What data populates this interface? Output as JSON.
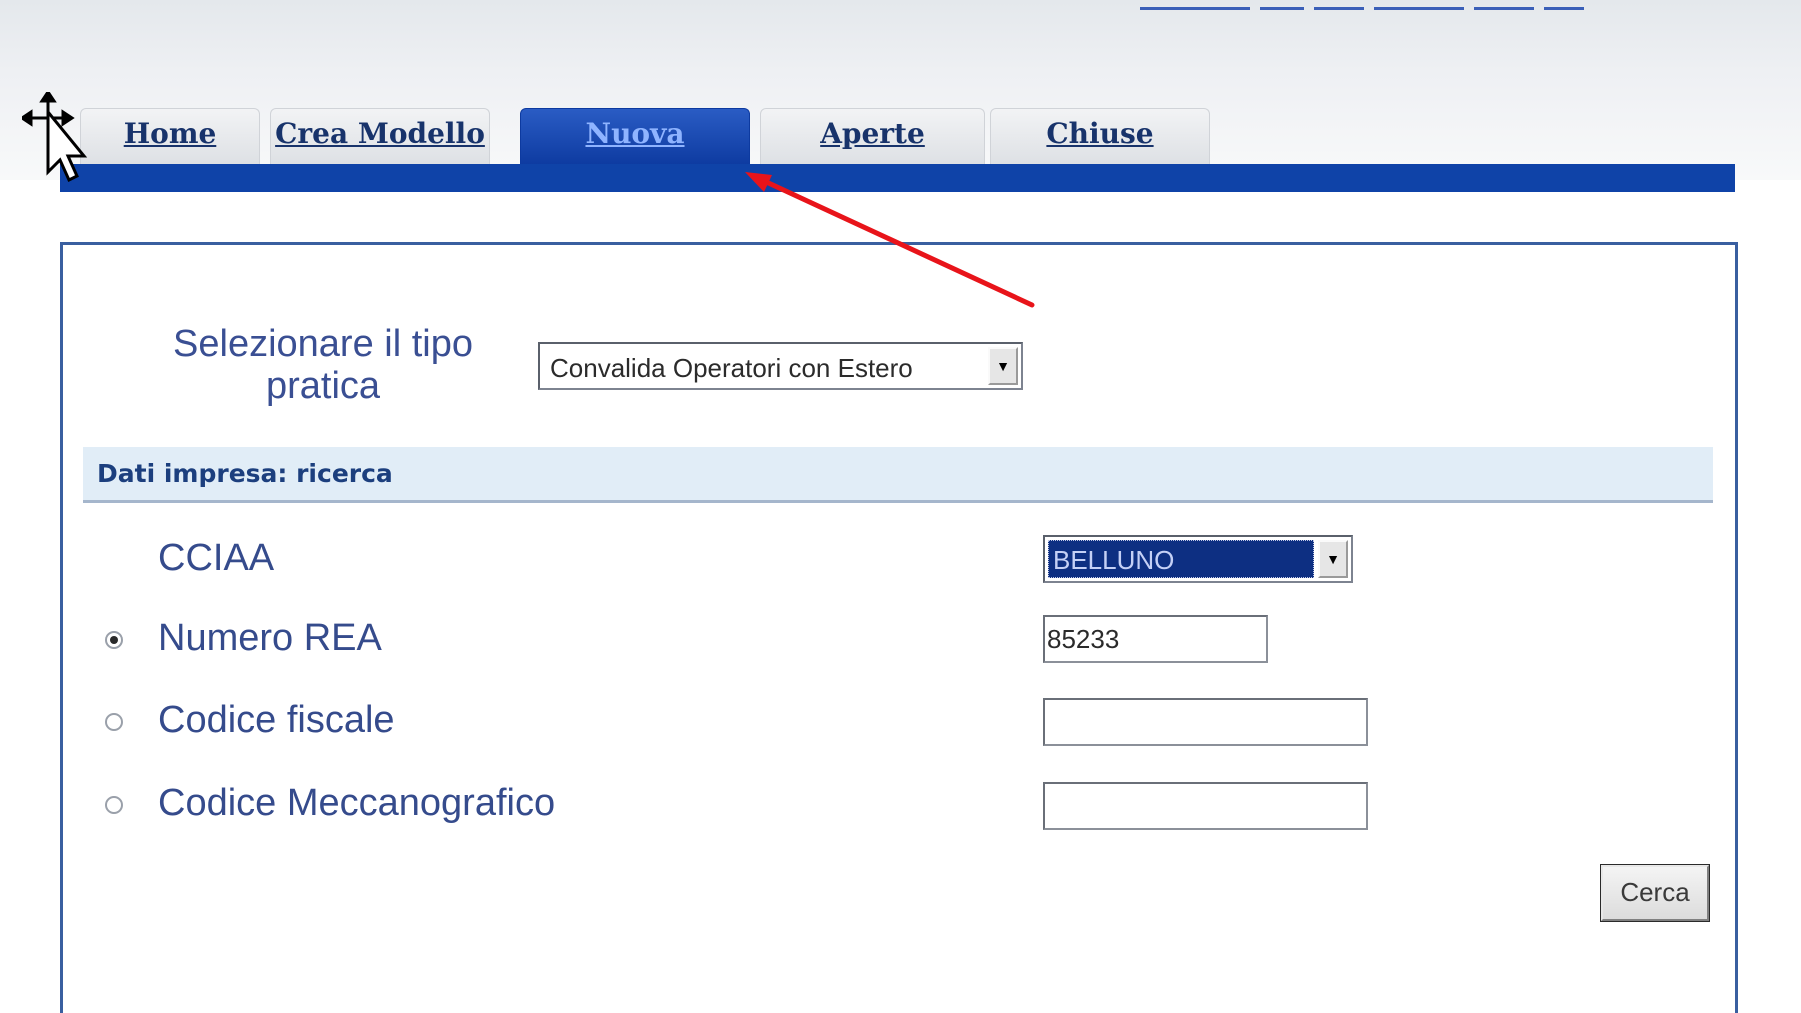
{
  "nav": {
    "tabs": [
      {
        "label": "Home",
        "active": false
      },
      {
        "label": "Crea Modello",
        "active": false
      },
      {
        "label": "Nuova",
        "active": true
      },
      {
        "label": "Aperte",
        "active": false
      },
      {
        "label": "Chiuse",
        "active": false
      }
    ]
  },
  "form": {
    "tipo_pratica_label": "Selezionare il tipo pratica",
    "tipo_pratica_value": "Convalida Operatori con Estero",
    "section_title": "Dati impresa: ricerca",
    "cciaa_label": "CCIAA",
    "cciaa_value": "BELLUNO",
    "numero_rea_label": "Numero REA",
    "numero_rea_value": "85233",
    "codice_fiscale_label": "Codice fiscale",
    "codice_fiscale_value": "",
    "codice_meccanografico_label": "Codice Meccanografico",
    "codice_meccanografico_value": "",
    "search_button": "Cerca",
    "selected_search_mode": "numero_rea"
  },
  "colors": {
    "nav_bar": "#0f43a8",
    "active_tab": "#0d3aa0",
    "annotation_arrow": "#e8141a",
    "label_text": "#354b8c"
  },
  "icons": {
    "dropdown": "triangle-down-icon",
    "cursor": "move-cursor-icon",
    "annotation": "red-arrow-icon"
  }
}
